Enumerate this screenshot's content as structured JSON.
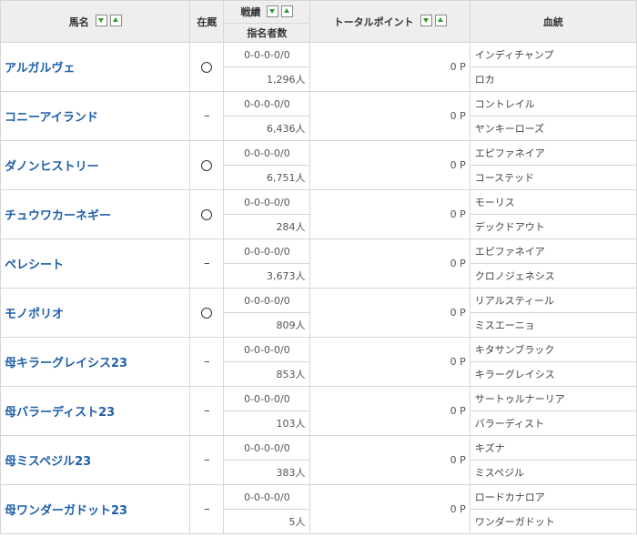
{
  "header": {
    "name_label": "馬名",
    "stock_label": "在厩",
    "record_label": "戦績",
    "nominees_label": "指名者数",
    "points_label": "トータルポイント",
    "bloodline_label": "血統"
  },
  "horses": [
    {
      "name": "アルガルヴェ",
      "stock": "○",
      "record": "0-0-0-0/0",
      "nominees": "1,296人",
      "points": "0 P",
      "sire": "インディチャンプ",
      "dam": "ロカ"
    },
    {
      "name": "コニーアイランド",
      "stock": "–",
      "record": "0-0-0-0/0",
      "nominees": "6,436人",
      "points": "0 P",
      "sire": "コントレイル",
      "dam": "ヤンキーローズ"
    },
    {
      "name": "ダノンヒストリー",
      "stock": "○",
      "record": "0-0-0-0/0",
      "nominees": "6,751人",
      "points": "0 P",
      "sire": "エピファネイア",
      "dam": "コーステッド"
    },
    {
      "name": "チュウワカーネギー",
      "stock": "○",
      "record": "0-0-0-0/0",
      "nominees": "284人",
      "points": "0 P",
      "sire": "モーリス",
      "dam": "デックドアウト"
    },
    {
      "name": "ペレシート",
      "stock": "–",
      "record": "0-0-0-0/0",
      "nominees": "3,673人",
      "points": "0 P",
      "sire": "エピファネイア",
      "dam": "クロノジェネシス"
    },
    {
      "name": "モノポリオ",
      "stock": "○",
      "record": "0-0-0-0/0",
      "nominees": "809人",
      "points": "0 P",
      "sire": "リアルスティール",
      "dam": "ミスエーニョ"
    },
    {
      "name": "母キラーグレイシス23",
      "stock": "–",
      "record": "0-0-0-0/0",
      "nominees": "853人",
      "points": "0 P",
      "sire": "キタサンブラック",
      "dam": "キラーグレイシス"
    },
    {
      "name": "母バラーディスト23",
      "stock": "–",
      "record": "0-0-0-0/0",
      "nominees": "103人",
      "points": "0 P",
      "sire": "サートゥルナーリア",
      "dam": "バラーディスト"
    },
    {
      "name": "母ミスペジル23",
      "stock": "–",
      "record": "0-0-0-0/0",
      "nominees": "383人",
      "points": "0 P",
      "sire": "キズナ",
      "dam": "ミスペジル"
    },
    {
      "name": "母ワンダーガドット23",
      "stock": "–",
      "record": "0-0-0-0/0",
      "nominees": "5人",
      "points": "0 P",
      "sire": "ロードカナロア",
      "dam": "ワンダーガドット"
    }
  ]
}
